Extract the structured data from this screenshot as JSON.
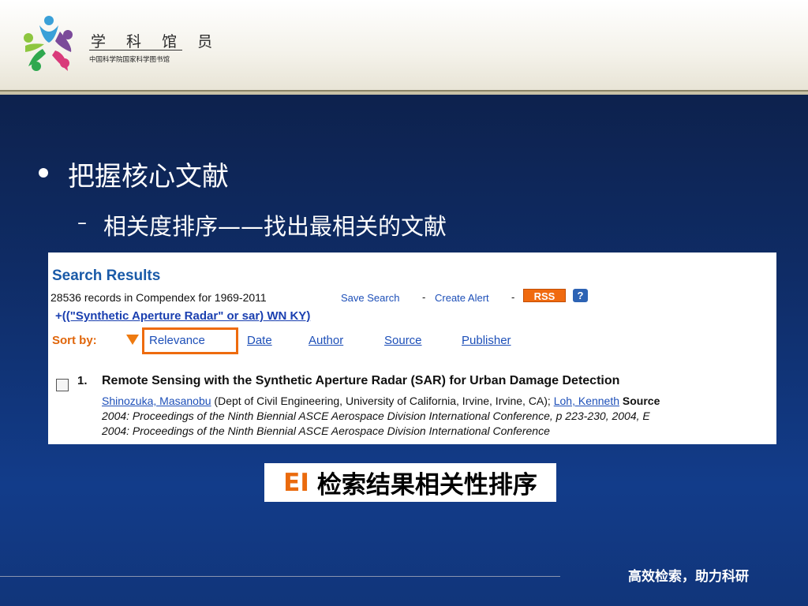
{
  "header": {
    "logo_title": "学 科 馆 员",
    "logo_subtitle": "中国科学院国家科学图书馆",
    "logo_icon": "people-circle-logo-icon"
  },
  "slide": {
    "bullet1": "把握核心文献",
    "bullet2_dash": "–",
    "bullet2": "相关度排序——找出最相关的文献"
  },
  "screenshot": {
    "title": "Search Results",
    "count_text": "28536 records in Compendex for 1969-2011",
    "save_search": "Save Search",
    "separator": "-",
    "create_alert": "Create Alert",
    "rss_label": "RSS",
    "help_label": "?",
    "query_prefix": "+",
    "query": "((\"Synthetic Aperture Radar\" or sar) WN KY)",
    "sort_by_label": "Sort by:",
    "sort_options": [
      "Relevance",
      "Date",
      "Author",
      "Source",
      "Publisher"
    ],
    "result": {
      "number": "1.",
      "title": "Remote Sensing with the Synthetic Aperture Radar (SAR) for Urban Damage Detection",
      "author1": "Shinozuka, Masanobu",
      "affiliation": " (Dept of Civil Engineering, University of California, Irvine, Irvine, CA); ",
      "author2": "Loh, Kenneth",
      "source_label": " Source",
      "line2": "2004: Proceedings of the Ninth Biennial ASCE Aerospace Division International Conference, p 223-230, 2004, E",
      "line3": "2004: Proceedings of the Ninth Biennial ASCE Aerospace Division International Conference"
    }
  },
  "caption": {
    "ei": "EI",
    "text": "检索结果相关性排序"
  },
  "footer": {
    "text": "高效检索，助力科研"
  },
  "colors": {
    "accent_orange": "#ea6a0d",
    "link_blue": "#1d4fb8",
    "background_navy": "#0f2c66"
  }
}
